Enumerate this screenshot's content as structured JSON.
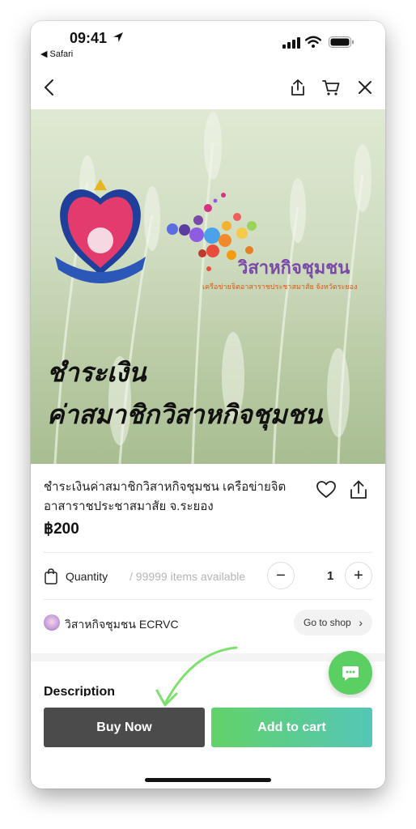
{
  "status_bar": {
    "time": "09:41",
    "back_app": "◀ Safari"
  },
  "nav": {
    "back_icon": "chevron-left-icon",
    "share_icon": "share-icon",
    "cart_icon": "cart-icon",
    "close_icon": "close-icon"
  },
  "hero": {
    "brand_name": "วิสาหกิจชุมชน",
    "brand_sub": "เครือข่ายจิตอาสาราชประชาสมาสัย จังหวัดระยอง",
    "title_line1": "ชำระเงิน",
    "title_line2": "ค่าสมาชิกวิสาหกิจชุมชน"
  },
  "product": {
    "name": "ชำระเงินค่าสมาชิกวิสาหกิจชุมชน เครือข่ายจิต อาสาราชประชาสมาสัย จ.ระยอง",
    "price": "฿200"
  },
  "quantity": {
    "label": "Quantity",
    "available": "/ 99999 items available",
    "minus": "−",
    "value": "1",
    "plus": "+"
  },
  "shop": {
    "name": "วิสาหกิจชุมชน ECRVC",
    "go_label": "Go to shop",
    "chevron": "›"
  },
  "description": {
    "heading": "Description"
  },
  "actions": {
    "buy_now": "Buy Now",
    "add_to_cart": "Add to cart"
  },
  "colors": {
    "accent_green": "#5ccf63",
    "dark_button": "#4b4b4b",
    "gradient_end": "#55c6b6"
  }
}
